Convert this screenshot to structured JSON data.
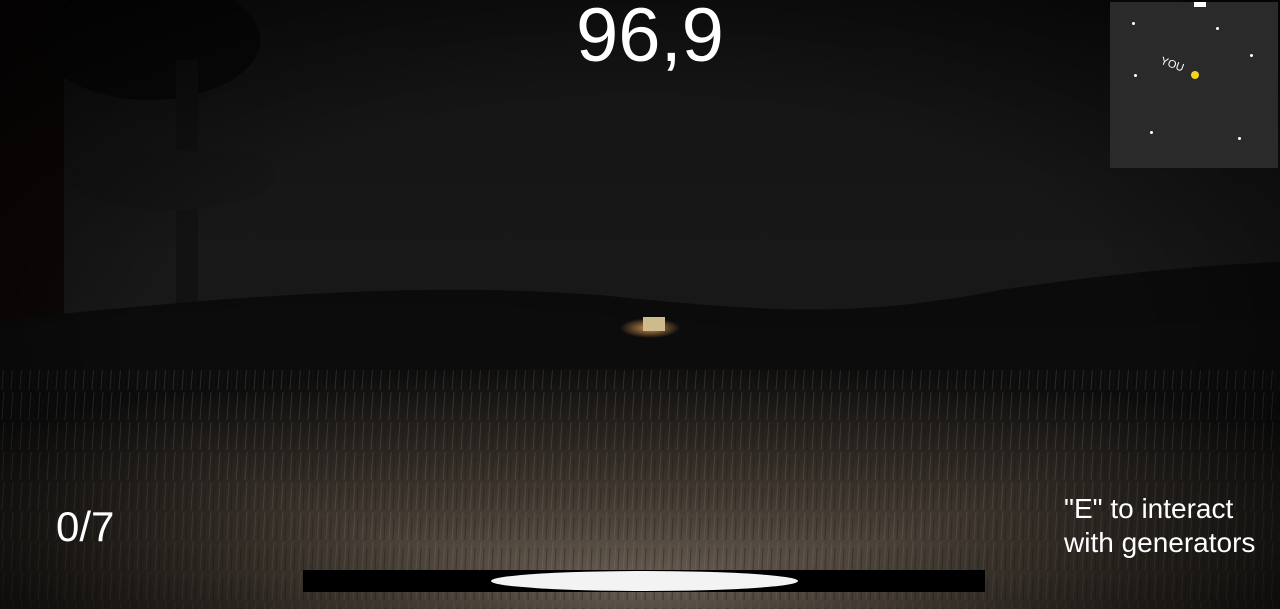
{
  "hud": {
    "timer": "96,9",
    "generators_counter": "0/7",
    "hint_line1": "\"E\" to interact",
    "hint_line2": "with generators"
  },
  "minimap": {
    "player_label": "YOU",
    "player_color": "#f4d21f",
    "background_color": "#2a2a2a"
  },
  "stamina": {
    "level": 0.45
  },
  "scene": {
    "sky_color": "#121212",
    "field_color": "#3b332b"
  }
}
